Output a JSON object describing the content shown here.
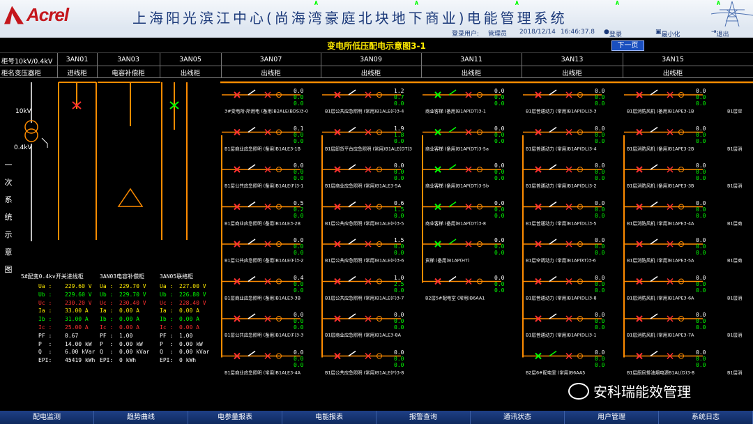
{
  "app": {
    "brand": "Acrel",
    "title": "上海阳光滨江中心(尚海湾豪庭北块地下商业)电能管理系统"
  },
  "user": {
    "label": "登录用户:",
    "name": "管理员",
    "date": "2018/12/14",
    "time": "16:46:37.8",
    "login": "登录",
    "minimize": "最小化",
    "exit": "退出"
  },
  "subtitle": "变电所低压配电示意图3-1",
  "next_page": "下一页",
  "row_labels": {
    "cabinet_no": "柜号10kV/0.4kV",
    "cabinet_name": "柜名变压器柜"
  },
  "cabinets": [
    {
      "no": "3AN01",
      "name": "进线柜"
    },
    {
      "no": "3AN03",
      "name": "电容补偿柜"
    },
    {
      "no": "3AN05",
      "name": "出线柜"
    },
    {
      "no": "3AN07",
      "name": "出线柜"
    },
    {
      "no": "3AN09",
      "name": "出线柜"
    },
    {
      "no": "3AN11",
      "name": "出线柜"
    },
    {
      "no": "3AN13",
      "name": "出线柜"
    },
    {
      "no": "3AN15",
      "name": "出线柜"
    }
  ],
  "vertical_label": "一次系统示意图",
  "voltages": {
    "hv": "10kV",
    "lv": "0.4kV"
  },
  "meters": [
    {
      "title": "5#配变0.4kv开关进线柜",
      "rows": [
        [
          "Ua :",
          "229.60 V"
        ],
        [
          "Ub :",
          "229.60 V"
        ],
        [
          "Uc :",
          "230.20 V"
        ],
        [
          "Ia :",
          "33.00 A"
        ],
        [
          "Ib :",
          "31.00 A"
        ],
        [
          "Ic :",
          "25.00 A"
        ],
        [
          "PF :",
          "0.67"
        ],
        [
          "P  :",
          "14.00 kW"
        ],
        [
          "Q  :",
          "6.00 kVar"
        ],
        [
          "EPI:",
          "45419 kWh"
        ]
      ]
    },
    {
      "title": "3AN03电容补偿柜",
      "rows": [
        [
          "Ua :",
          "229.70 V"
        ],
        [
          "Ub :",
          "229.70 V"
        ],
        [
          "Uc :",
          "230.40 V"
        ],
        [
          "Ia :",
          "0.00 A"
        ],
        [
          "Ib :",
          "0.00 A"
        ],
        [
          "Ic :",
          "0.00 A"
        ],
        [
          "PF :",
          "1.00"
        ],
        [
          "P  :",
          "0.00 kW"
        ],
        [
          "Q  :",
          "0.00 kVar"
        ],
        [
          "EPI:",
          "0 kWh"
        ]
      ]
    },
    {
      "title": "3AN05联络柜",
      "rows": [
        [
          "Ua :",
          "227.00 V"
        ],
        [
          "Ub :",
          "226.80 V"
        ],
        [
          "Uc :",
          "228.40 V"
        ],
        [
          "Ia :",
          "0.00 A"
        ],
        [
          "Ib :",
          "0.00 A"
        ],
        [
          "Ic :",
          "0.00 A"
        ],
        [
          "PF :",
          "1.00"
        ],
        [
          "P  :",
          "0.00 kW"
        ],
        [
          "Q  :",
          "0.00 kVar"
        ],
        [
          "EPI:",
          "0 kWh"
        ]
      ]
    }
  ],
  "meter_colors": [
    "#ffeb00",
    "#00ff00",
    "#ff3030",
    "#ffeb00",
    "#00ff00",
    "#ff3030",
    "#ffffff",
    "#ffffff",
    "#ffffff",
    "#ffffff"
  ],
  "feeders": [
    {
      "col": 0,
      "circuits": [
        {
          "name": "3#变电所-所用电 (备用)B2ALE(BDS)3-0",
          "vals": [
            "0.0",
            "0.0",
            "0.0"
          ]
        },
        {
          "name": "B1层商业应急照明 (备用)B1ALE3-1B",
          "vals": [
            "0.1",
            "0.0",
            "0.0"
          ]
        },
        {
          "name": "B1层公共应急照明 (备用)B1ALE(F)3-1",
          "vals": [
            "0.0",
            "0.0",
            "0.0"
          ]
        },
        {
          "name": "B1层商业应急照明 (备用)B1ALE3-2B",
          "vals": [
            "0.5",
            "0.2",
            "0.0"
          ]
        },
        {
          "name": "B1层公共应急照明 (备用)B1ALE(F)3-2",
          "vals": [
            "0.0",
            "0.0",
            "0.0"
          ]
        },
        {
          "name": "B1层商业应急照明 (备用)B1ALE3-3B",
          "vals": [
            "0.4",
            "0.0",
            "0.0"
          ]
        },
        {
          "name": "B1层公共应急照明 (备用)B1ALE(F)3-3",
          "vals": [
            "0.0",
            "0.0",
            "0.0"
          ]
        },
        {
          "name": "B1层商业应急照明 (常用)B1ALE3-4A",
          "vals": [
            "0.0",
            "0.0",
            "0.0"
          ]
        }
      ]
    },
    {
      "col": 1,
      "circuits": [
        {
          "name": "B1层公共应急照明 (常用)B1ALE(F)3-4",
          "vals": [
            "1.2",
            "0.7",
            "0.0"
          ]
        },
        {
          "name": "B1层卸货平台应急照明 (常用)B1ALE(DT)3",
          "vals": [
            "1.9",
            "1.8",
            "0.0"
          ]
        },
        {
          "name": "B1层商业应急照明 (常用)B1ALE3-5A",
          "vals": [
            "0.0",
            "0.0",
            "0.0"
          ]
        },
        {
          "name": "B1层公共应急照明 (常用)B1ALE(F)3-5",
          "vals": [
            "0.6",
            "1.5",
            "0.0"
          ]
        },
        {
          "name": "B1层公共应急照明 (常用)B1ALE(F)3-6",
          "vals": [
            "1.5",
            "0.0",
            "0.0"
          ]
        },
        {
          "name": "B1层公共应急照明 (常用)B1ALE(F)3-7",
          "vals": [
            "1.0",
            "2.5",
            "0.0"
          ]
        },
        {
          "name": "B1层商业应急照明 (常用)B1ALE3-8A",
          "vals": [
            "0.0",
            "0.0",
            "0.0"
          ]
        },
        {
          "name": "B1层公共应急照明 (常用)B1ALE(F)3-8",
          "vals": [
            "0.0",
            "0.0",
            "0.0"
          ]
        }
      ]
    },
    {
      "col": 2,
      "circuits": [
        {
          "name": "商业客梯 (备用)B1AP(DT)3-1",
          "vals": [
            "0.0",
            "0.0",
            "0.0"
          ]
        },
        {
          "name": "商业客梯 (备用)B1AP(DT)3-5a",
          "vals": [
            "0.0",
            "0.0",
            "0.0"
          ]
        },
        {
          "name": "商业客梯 (备用)B1AP(DT)3-5b",
          "vals": [
            "0.0",
            "0.0",
            "0.0"
          ]
        },
        {
          "name": "商业客梯 (备用)B1AP(DT)3-8",
          "vals": [
            "0.0",
            "0.0",
            "0.0"
          ]
        },
        {
          "name": "货梯 (备用)B1AP(HT)",
          "vals": [
            "0.0",
            "0.0",
            "0.0"
          ]
        },
        {
          "name": "B2层5#配电室 (常用)B6AA1",
          "vals": [
            "0.0",
            "0.0",
            "0.0"
          ]
        }
      ]
    },
    {
      "col": 3,
      "circuits": [
        {
          "name": "B1层普通动力 (常用)B1AP(DL)3-3",
          "vals": [
            "0.0",
            "0.0",
            "0.0"
          ]
        },
        {
          "name": "B1层普通动力 (常用)B1AP(DL)3-4",
          "vals": [
            "0.0",
            "0.0",
            "0.0"
          ]
        },
        {
          "name": "B1层普通动力 (常用)B1AP(DL)3-2",
          "vals": [
            "0.0",
            "0.0",
            "0.0"
          ]
        },
        {
          "name": "B1层普通动力 (常用)B1AP(DL)3-5",
          "vals": [
            "0.0",
            "0.0",
            "0.0"
          ]
        },
        {
          "name": "B1层空调动力 (常用)B1AP(KT)3-6",
          "vals": [
            "0.0",
            "0.0",
            "0.0"
          ]
        },
        {
          "name": "B1层普通动力 (常用)B1AP(DL)3-8",
          "vals": [
            "0.0",
            "0.0",
            "0.0"
          ]
        },
        {
          "name": "B1层普通动力 (常用)B1AP(DL)3-1",
          "vals": [
            "0.0",
            "0.0",
            "0.0"
          ]
        },
        {
          "name": "B2层6#配电室 (常用)B6AA5",
          "vals": [
            "0.0",
            "0.0",
            "0.0"
          ]
        }
      ]
    },
    {
      "col": 4,
      "circuits": [
        {
          "name": "B1层消防风机 (备用)B1APE3-1B",
          "vals": [
            "0.0",
            "0.0",
            "0.0"
          ]
        },
        {
          "name": "B1层消防风机 (备用)B1APE3-2B",
          "vals": [
            "0.0",
            "0.0",
            "0.0"
          ]
        },
        {
          "name": "B1层消防风机 (备用)B1APE3-3B",
          "vals": [
            "0.0",
            "0.0",
            "0.0"
          ]
        },
        {
          "name": "B1层消防风机 (常用)B1APE3-4A",
          "vals": [
            "0.0",
            "0.0",
            "0.0"
          ]
        },
        {
          "name": "B1层消防风机 (常用)B1APE3-5A",
          "vals": [
            "0.0",
            "0.0",
            "0.0"
          ]
        },
        {
          "name": "B1层消防风机 (常用)B1APE3-6A",
          "vals": [
            "0.0",
            "0.0",
            "0.0"
          ]
        },
        {
          "name": "B1层消防风机 (常用)B1APE3-7A",
          "vals": [
            "0.0",
            "0.0",
            "0.0"
          ]
        },
        {
          "name": "B1层厨房排油烟电源B1AL(D)3-8",
          "vals": [
            "0.0",
            "0.0",
            "0.0"
          ]
        }
      ]
    }
  ],
  "edge_labels": [
    "B1层空",
    "B1层消",
    "B1层消",
    "B1层商",
    "B1层商",
    "B1层消",
    "B1层消",
    "B1层消"
  ],
  "unit_a": "A",
  "footer": [
    "配电监测",
    "趋势曲线",
    "电参量报表",
    "电能报表",
    "报警查询",
    "通讯状态",
    "用户管理",
    "系统日志"
  ],
  "watermark": "安科瑞能效管理",
  "colors": {
    "bus": "#ff8c00",
    "breaker_off": "#ff3030",
    "breaker_on": "#00ff00",
    "title": "#ffeb00"
  }
}
